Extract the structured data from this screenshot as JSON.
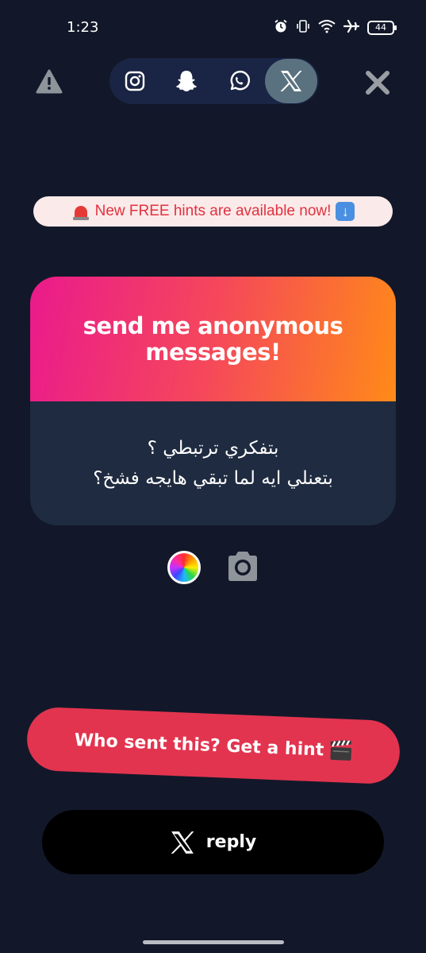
{
  "status_bar": {
    "time": "1:23",
    "battery": "44",
    "icons": [
      "alarm-icon",
      "vibrate-icon",
      "wifi-icon",
      "airplane-icon",
      "battery-icon"
    ]
  },
  "nav": {
    "left_icon": "warning-icon",
    "right_icon": "close-icon",
    "social": [
      {
        "name": "instagram",
        "icon": "instagram-icon",
        "active": false
      },
      {
        "name": "snapchat",
        "icon": "snapchat-icon",
        "active": false
      },
      {
        "name": "whatsapp",
        "icon": "whatsapp-icon",
        "active": false
      },
      {
        "name": "x",
        "icon": "x-logo-icon",
        "active": true
      }
    ]
  },
  "banner": {
    "text": "New FREE hints are available now!",
    "leading_icon": "siren-icon",
    "trailing_icon": "down-arrow-icon",
    "bg_color": "#fbeaea",
    "text_color": "#e0323e"
  },
  "card": {
    "title": "send me anonymous messages!",
    "message_line1": "بتفكري ترتبطي ؟",
    "message_line2": "بتعنلي ايه لما تبقي هايجه فشخ؟"
  },
  "tools": {
    "color_icon": "color-wheel-icon",
    "camera_icon": "camera-icon"
  },
  "buttons": {
    "hint_label": "Who sent this? Get a hint",
    "hint_icon": "clapperboard-icon",
    "reply_label": "reply",
    "reply_icon": "x-logo-icon"
  },
  "colors": {
    "background": "#121829",
    "card_gradient_start": "#ea1a8c",
    "card_gradient_end": "#ff8a18",
    "card_body": "#1f2b40",
    "hint_button": "#e2344f",
    "reply_button": "#000000"
  }
}
